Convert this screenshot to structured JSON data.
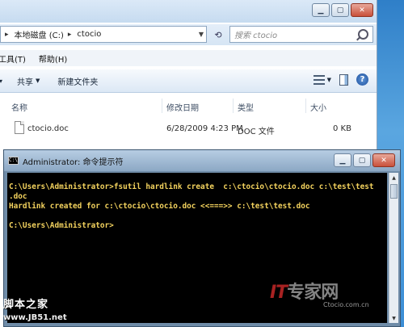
{
  "explorer": {
    "address": {
      "crumbs": [
        "本地磁盘 (C:)",
        "ctocio"
      ],
      "separator": "▸"
    },
    "search": {
      "placeholder": "搜索 ctocio"
    },
    "menu": [
      "工具(T)",
      "帮助(H)"
    ],
    "toolbar": {
      "share_label": "共享",
      "new_folder_label": "新建文件夹"
    },
    "columns": [
      "名称",
      "修改日期",
      "类型",
      "大小"
    ],
    "files": [
      {
        "name": "ctocio.doc",
        "modified": "6/28/2009 4:23 PM",
        "type": "DOC 文件",
        "size": "0 KB"
      }
    ]
  },
  "cmd": {
    "title": "Administrator: 命令提示符",
    "icon_text": "C:\\",
    "lines": [
      "C:\\Users\\Administrator>fsutil hardlink create  c:\\ctocio\\ctocio.doc c:\\test\\test",
      ".doc",
      "Hardlink created for c:\\ctocio\\ctocio.doc <<===>> c:\\test\\test.doc",
      "",
      "C:\\Users\\Administrator>"
    ],
    "text_color": "#f4d35e"
  },
  "watermarks": {
    "left_title": "脚本之家",
    "left_url": "www.JB51.net",
    "right_it": "IT",
    "right_title": "专家网",
    "right_url": "Ctocio.com.cn"
  },
  "colors": {
    "desktop": "#3c8ed6",
    "console_bg": "#000000",
    "close_button": "#c9503a"
  }
}
